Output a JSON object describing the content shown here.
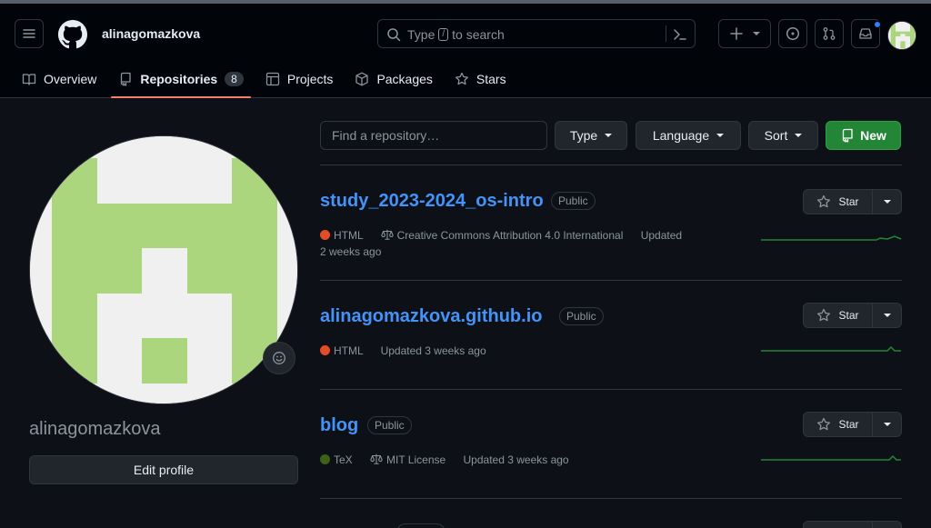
{
  "header": {
    "username": "alinagomazkova",
    "search_prefix": "Type",
    "search_key": "/",
    "search_suffix": "to search"
  },
  "tabs": [
    {
      "label": "Overview"
    },
    {
      "label": "Repositories",
      "count": "8"
    },
    {
      "label": "Projects"
    },
    {
      "label": "Packages"
    },
    {
      "label": "Stars"
    }
  ],
  "profile": {
    "login": "alinagomazkova",
    "edit_label": "Edit profile"
  },
  "filters": {
    "find_placeholder": "Find a repository…",
    "type_label": "Type",
    "language_label": "Language",
    "sort_label": "Sort",
    "new_label": "New"
  },
  "repos": [
    {
      "name": "study_2023-2024_os-intro",
      "visibility": "Public",
      "language": "HTML",
      "language_color": "#e34c26",
      "license": "Creative Commons Attribution 4.0 International",
      "updated_1": "Updated",
      "updated_2": "2 weeks ago",
      "star_label": "Star"
    },
    {
      "name": "alinagomazkova.github.io",
      "visibility": "Public",
      "language": "HTML",
      "language_color": "#e34c26",
      "updated": "Updated 3 weeks ago",
      "star_label": "Star"
    },
    {
      "name": "blog",
      "visibility": "Public",
      "language": "TeX",
      "language_color": "#3d6117",
      "license": "MIT License",
      "updated": "Updated 3 weeks ago",
      "star_label": "Star"
    }
  ],
  "colors": {
    "accent": "#4493f8",
    "new_button": "#238636",
    "identicon": "#acd67e",
    "tab_underline": "#f78166"
  }
}
